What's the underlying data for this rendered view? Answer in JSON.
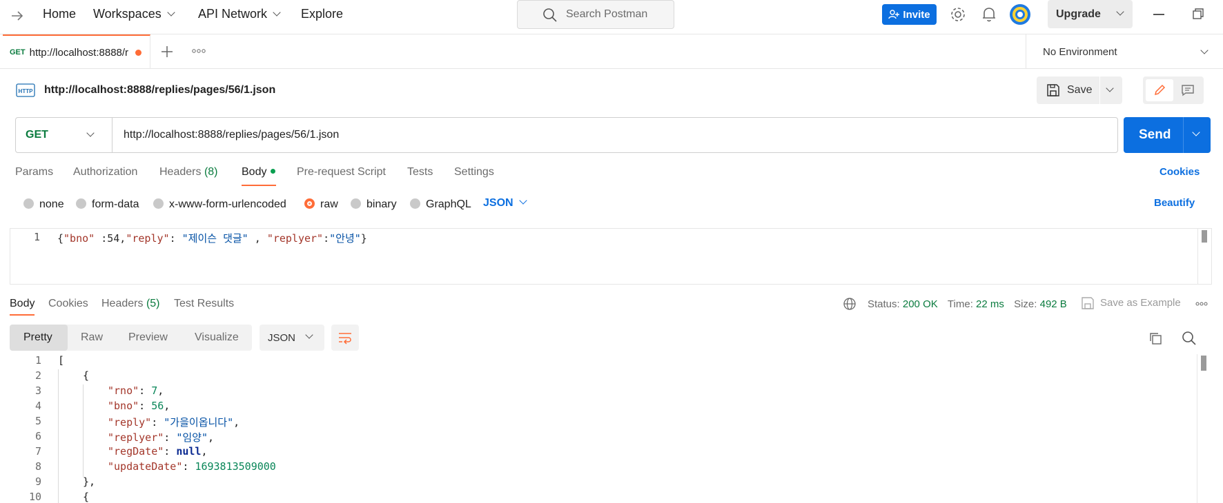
{
  "topbar": {
    "nav": [
      "Home",
      "Workspaces",
      "API Network",
      "Explore"
    ],
    "search_placeholder": "Search Postman",
    "invite_label": "Invite",
    "upgrade_label": "Upgrade"
  },
  "tabs": {
    "active_tab": {
      "method": "GET",
      "label": "http://localhost:8888/r"
    },
    "environment": "No Environment"
  },
  "request": {
    "title": "http://localhost:8888/replies/pages/56/1.json",
    "save_label": "Save",
    "method": "GET",
    "url": "http://localhost:8888/replies/pages/56/1.json",
    "send_label": "Send",
    "tabs": [
      {
        "label": "Params"
      },
      {
        "label": "Authorization"
      },
      {
        "label": "Headers",
        "count": "(8)"
      },
      {
        "label": "Body"
      },
      {
        "label": "Pre-request Script"
      },
      {
        "label": "Tests"
      },
      {
        "label": "Settings"
      }
    ],
    "cookies_label": "Cookies",
    "body_types": [
      "none",
      "form-data",
      "x-www-form-urlencoded",
      "raw",
      "binary",
      "GraphQL"
    ],
    "body_format": "JSON",
    "beautify_label": "Beautify",
    "body_line_number": "1",
    "body_text": {
      "k1": "\"bno\"",
      "v1": ":54,",
      "k2": "\"reply\"",
      "v2": "\"제이슨 댓글\"",
      "sep": ",",
      "k3": "\"replyer\"",
      "v3": "\"안녕\""
    }
  },
  "response": {
    "tabs": [
      {
        "label": "Body"
      },
      {
        "label": "Cookies"
      },
      {
        "label": "Headers",
        "count": "(5)"
      },
      {
        "label": "Test Results"
      }
    ],
    "status_label": "Status:",
    "status_value": "200 OK",
    "time_label": "Time:",
    "time_value": "22 ms",
    "size_label": "Size:",
    "size_value": "492 B",
    "save_example_label": "Save as Example",
    "views": [
      "Pretty",
      "Raw",
      "Preview",
      "Visualize"
    ],
    "format": "JSON",
    "line_numbers": [
      "1",
      "2",
      "3",
      "4",
      "5",
      "6",
      "7",
      "8",
      "9",
      "10"
    ],
    "code": {
      "l1": "[",
      "l2": "{",
      "rno_key": "\"rno\"",
      "rno_val": "7",
      "bno_key": "\"bno\"",
      "bno_val": "56",
      "reply_key": "\"reply\"",
      "reply_val": "\"가을이옵니다\"",
      "replyer_key": "\"replyer\"",
      "replyer_val": "\"임양\"",
      "regDate_key": "\"regDate\"",
      "regDate_val": "null",
      "updateDate_key": "\"updateDate\"",
      "updateDate_val": "1693813509000",
      "l9": "},",
      "l10": "{"
    }
  },
  "colors": {
    "accent": "#ff6c37",
    "primary": "#0c6fe0",
    "status_green": "#0a7b3e"
  }
}
